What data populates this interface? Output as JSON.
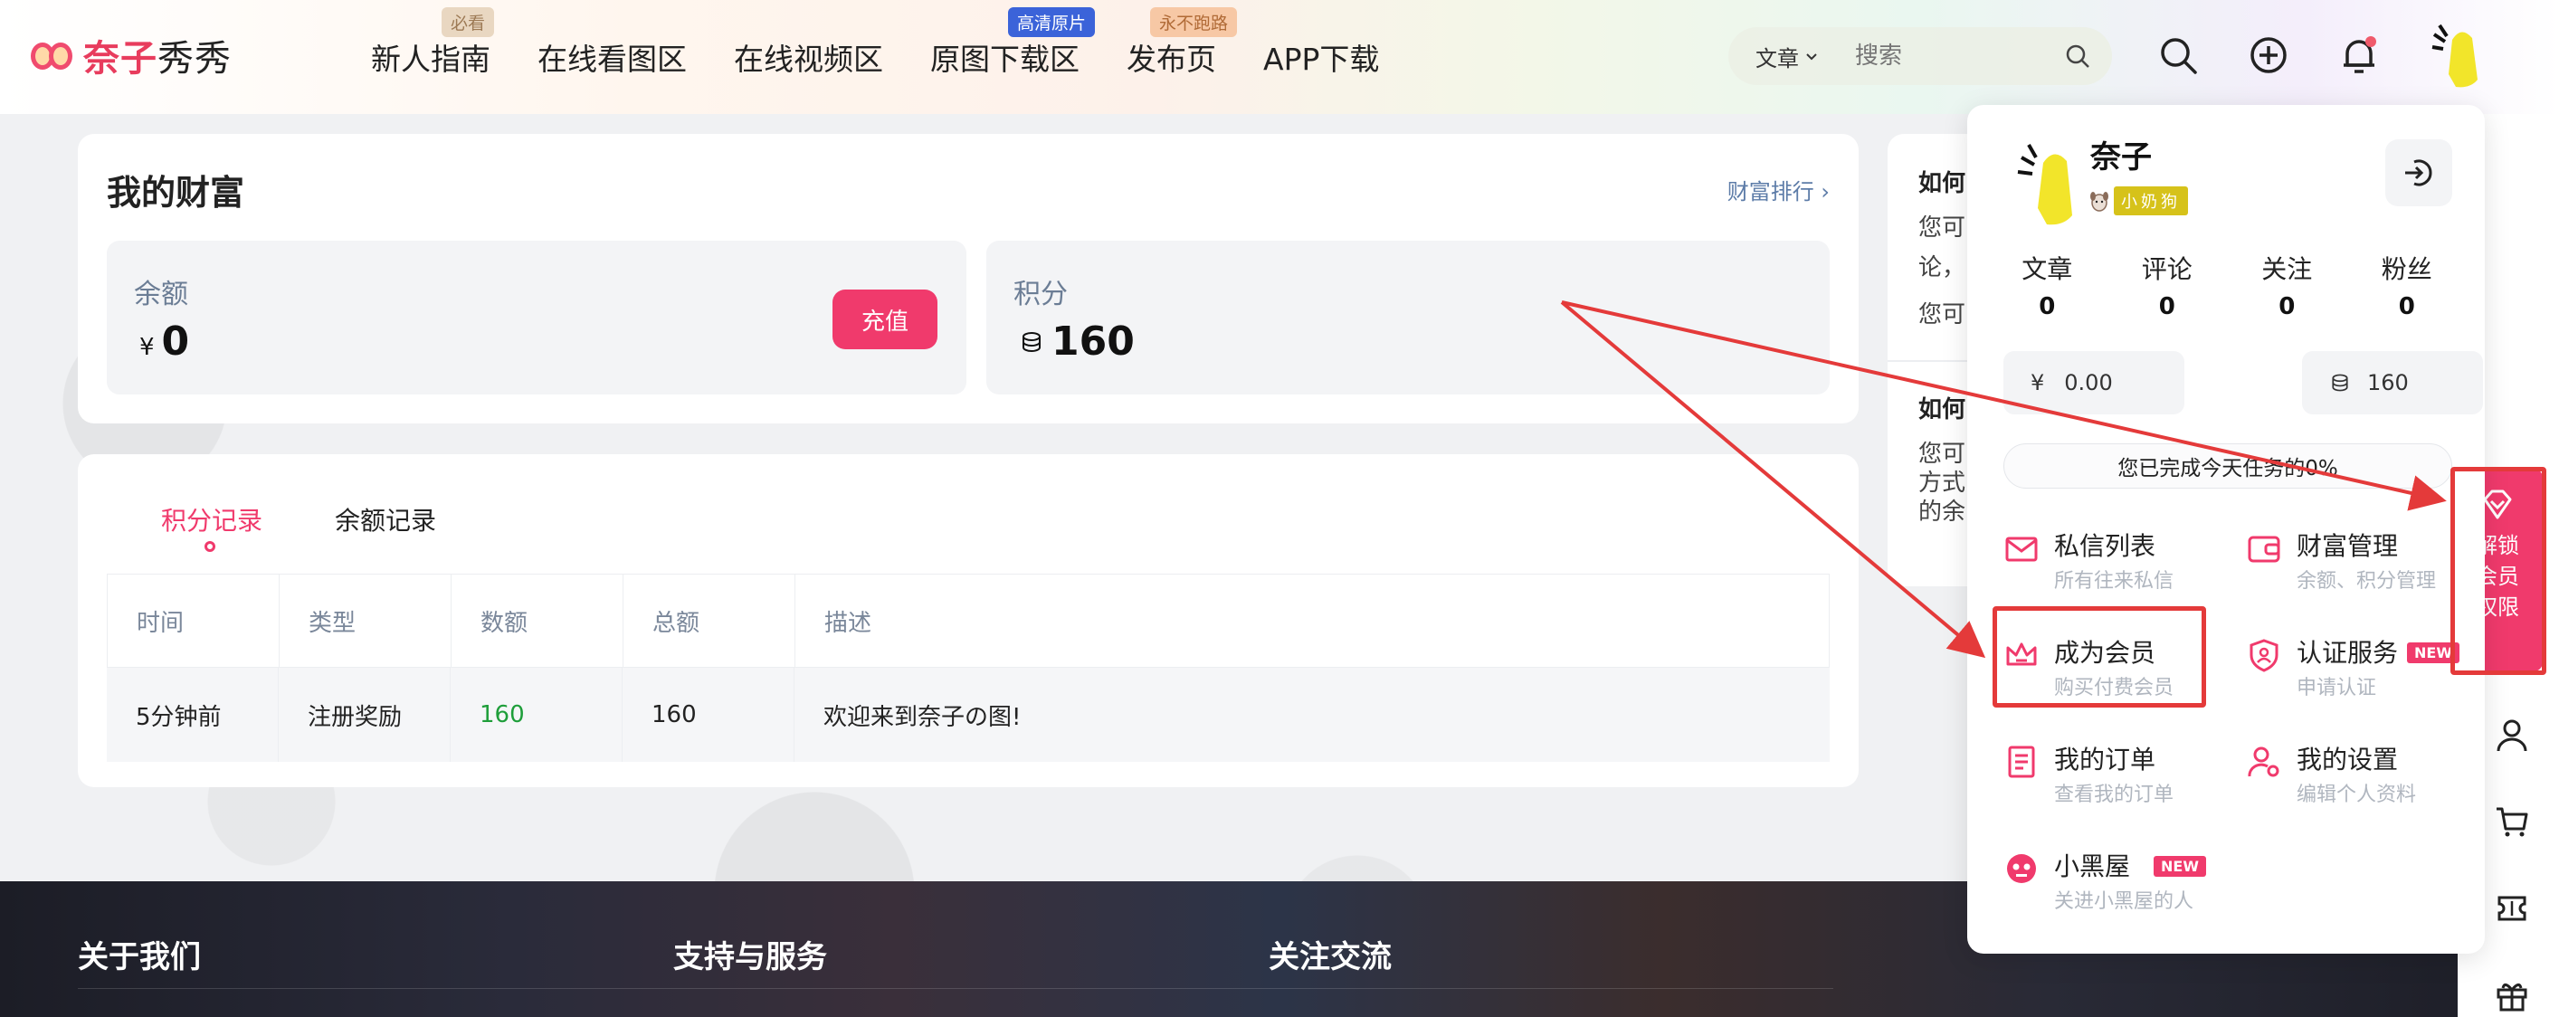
{
  "header": {
    "logo_text": "奈子",
    "logo_text_b": "秀秀",
    "nav": [
      {
        "label": "新人指南",
        "badge": "必看",
        "badge_style": "tan"
      },
      {
        "label": "在线看图区",
        "badge": "",
        "badge_style": ""
      },
      {
        "label": "在线视频区",
        "badge": "",
        "badge_style": ""
      },
      {
        "label": "原图下载区",
        "badge": "高清原片",
        "badge_style": "blue"
      },
      {
        "label": "发布页",
        "badge": "永不跑路",
        "badge_style": "orange"
      },
      {
        "label": "APP下载",
        "badge": "",
        "badge_style": ""
      }
    ],
    "search": {
      "category": "文章",
      "placeholder": "搜索"
    },
    "icons": [
      "search-icon",
      "add-icon",
      "bell-icon",
      "avatar"
    ]
  },
  "wealth": {
    "title": "我的财富",
    "rank_link": "财富排行",
    "balance_label": "余额",
    "balance_currency": "¥",
    "balance_value": "0",
    "recharge_label": "充值",
    "points_label": "积分",
    "points_value": "160"
  },
  "records": {
    "tabs": [
      "积分记录",
      "余额记录"
    ],
    "active_tab": 0,
    "columns": [
      "时间",
      "类型",
      "数额",
      "总额",
      "描述"
    ],
    "rows": [
      {
        "time": "5分钟前",
        "type": "注册奖励",
        "amount": "160",
        "total": "160",
        "desc": "欢迎来到奈子の图!"
      }
    ]
  },
  "side_card": {
    "title1": "如何",
    "text1a": "您可",
    "text1b": "论，",
    "text1c": "您可",
    "title2": "如何",
    "text2a": "您可",
    "text2b": "方式",
    "text2c": "的余"
  },
  "footer": {
    "cols": [
      "关于我们",
      "支持与服务",
      "关注交流"
    ]
  },
  "dropdown": {
    "name": "奈子",
    "level": "小奶狗",
    "stats": [
      {
        "label": "文章",
        "value": "0"
      },
      {
        "label": "评论",
        "value": "0"
      },
      {
        "label": "关注",
        "value": "0"
      },
      {
        "label": "粉丝",
        "value": "0"
      }
    ],
    "money_symbol": "¥",
    "money": "0.00",
    "points": "160",
    "task": "您已完成今天任务的0%",
    "items": [
      {
        "title": "私信列表",
        "sub": "所有往来私信",
        "new": ""
      },
      {
        "title": "财富管理",
        "sub": "余额、积分管理",
        "new": ""
      },
      {
        "title": "成为会员",
        "sub": "购买付费会员",
        "new": ""
      },
      {
        "title": "认证服务",
        "sub": "申请认证",
        "new": "NEW"
      },
      {
        "title": "我的订单",
        "sub": "查看我的订单",
        "new": ""
      },
      {
        "title": "我的设置",
        "sub": "编辑个人资料",
        "new": ""
      },
      {
        "title": "小黑屋",
        "sub": "关进小黑屋的人",
        "new": "NEW"
      }
    ]
  },
  "sidebar": {
    "unlock_lines": [
      "解锁",
      "会员",
      "权限"
    ]
  },
  "colors": {
    "accent": "#f03a6c",
    "annotation": "#e43a3a",
    "link": "#5d7ca8",
    "amount_green": "#1e9e3a"
  }
}
